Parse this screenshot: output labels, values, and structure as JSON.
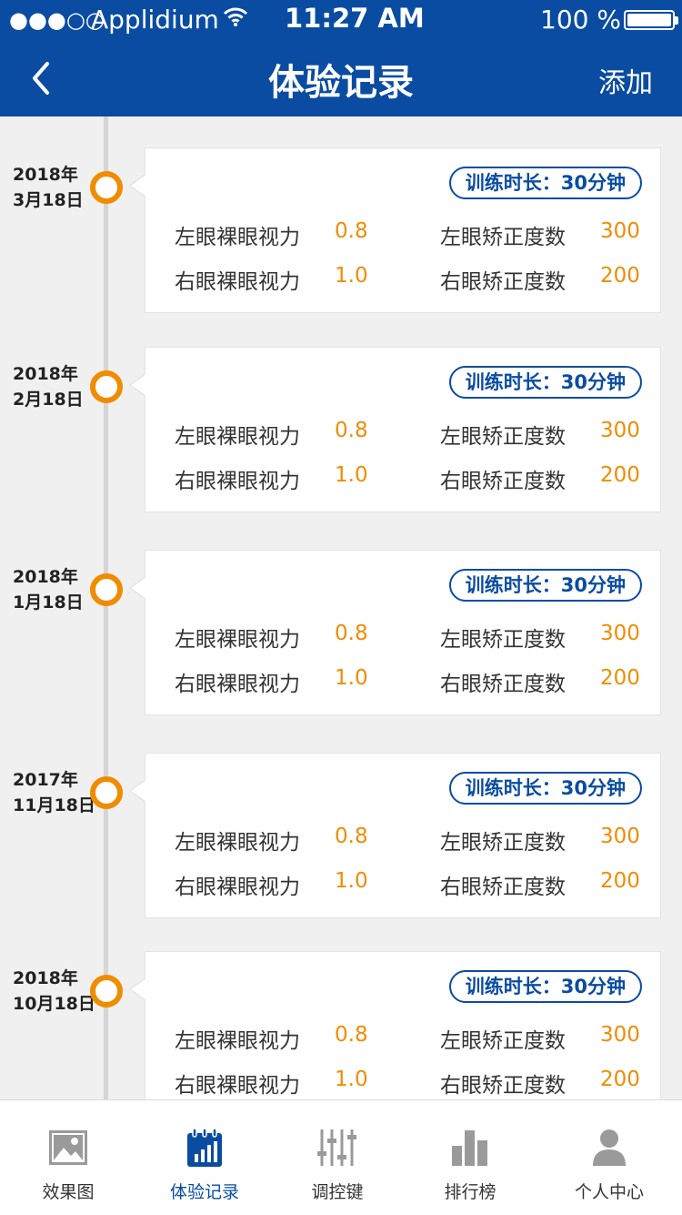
{
  "status_bar": {
    "signal": "●●●○○",
    "carrier": "Applidium",
    "time": "11:27 AM",
    "battery": "100 %"
  },
  "nav": {
    "title": "体验记录",
    "add_label": "添加"
  },
  "colors": {
    "primary": "#0a4ca2",
    "accent": "#f08c00"
  },
  "labels": {
    "left_naked": "左眼裸眼视力",
    "right_naked": "右眼裸眼视力",
    "left_corr": "左眼矫正度数",
    "right_corr": "右眼矫正度数"
  },
  "records": [
    {
      "year": "2018年",
      "day": "3月18日",
      "badge": "训练时长：30分钟",
      "left_naked": "0.8",
      "right_naked": "1.0",
      "left_corr": "300",
      "right_corr": "200"
    },
    {
      "year": "2018年",
      "day": "2月18日",
      "badge": "训练时长：30分钟",
      "left_naked": "0.8",
      "right_naked": "1.0",
      "left_corr": "300",
      "right_corr": "200"
    },
    {
      "year": "2018年",
      "day": "1月18日",
      "badge": "训练时长：30分钟",
      "left_naked": "0.8",
      "right_naked": "1.0",
      "left_corr": "300",
      "right_corr": "200"
    },
    {
      "year": "2017年",
      "day": "11月18日",
      "badge": "训练时长：30分钟",
      "left_naked": "0.8",
      "right_naked": "1.0",
      "left_corr": "300",
      "right_corr": "200"
    },
    {
      "year": "2018年",
      "day": "10月18日",
      "badge": "训练时长：30分钟",
      "left_naked": "0.8",
      "right_naked": "1.0",
      "left_corr": "300",
      "right_corr": "200"
    }
  ],
  "tabs": [
    {
      "label": "效果图",
      "icon": "image-icon",
      "active": false
    },
    {
      "label": "体验记录",
      "icon": "calendar-chart-icon",
      "active": true
    },
    {
      "label": "调控键",
      "icon": "sliders-icon",
      "active": false
    },
    {
      "label": "排行榜",
      "icon": "bar-chart-icon",
      "active": false
    },
    {
      "label": "个人中心",
      "icon": "user-icon",
      "active": false
    }
  ]
}
